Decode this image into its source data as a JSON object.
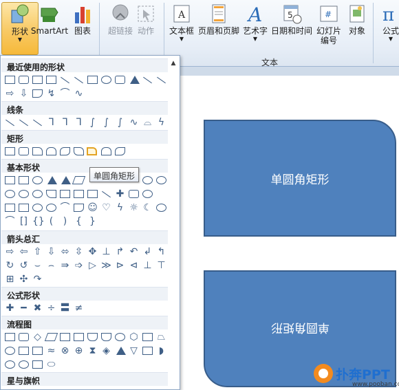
{
  "ribbon": {
    "buttons": [
      {
        "id": "shapes",
        "label": "形状",
        "icon": "shapes-icon",
        "has_dropdown": true,
        "active": true
      },
      {
        "id": "smartart",
        "label": "SmartArt",
        "icon": "smartart-icon"
      },
      {
        "id": "chart",
        "label": "图表",
        "icon": "chart-icon"
      },
      {
        "id": "hyperlink",
        "label": "超链接",
        "icon": "hyperlink-icon",
        "disabled": true
      },
      {
        "id": "action",
        "label": "动作",
        "icon": "action-icon",
        "disabled": true
      },
      {
        "id": "textbox",
        "label": "文本框",
        "icon": "textbox-icon",
        "has_dropdown": true
      },
      {
        "id": "header_footer",
        "label": "页眉和页脚",
        "icon": "header-footer-icon"
      },
      {
        "id": "wordart",
        "label": "艺术字",
        "icon": "wordart-icon",
        "has_dropdown": true
      },
      {
        "id": "datetime",
        "label": "日期和时间",
        "icon": "datetime-icon"
      },
      {
        "id": "slide_number",
        "label": "幻灯片编号",
        "label_line1": "幻灯片",
        "label_line2": "编号",
        "icon": "slide-number-icon"
      },
      {
        "id": "object",
        "label": "对象",
        "icon": "object-icon"
      },
      {
        "id": "equation",
        "label": "公式",
        "icon": "equation-icon",
        "has_dropdown": true
      }
    ],
    "group_text_label": "文本"
  },
  "shapes_panel": {
    "sections": [
      {
        "title": "最近使用的形状"
      },
      {
        "title": "线条"
      },
      {
        "title": "矩形"
      },
      {
        "title": "基本形状"
      },
      {
        "title": "箭头总汇"
      },
      {
        "title": "公式形状"
      },
      {
        "title": "流程图"
      },
      {
        "title": "星与旗帜"
      }
    ],
    "tooltip": "单圆角矩形"
  },
  "slide": {
    "shape1_text": "单圆角矩形",
    "shape2_text": "单圆角矩形",
    "shape_fill": "#4f81bd",
    "shape_border": "#385d8a"
  },
  "watermark": {
    "brand": "扑奔PPT",
    "url": "www.pooban.com"
  },
  "colors": {
    "ribbon_bg": "#e7eef7",
    "active_button": "#f8c964",
    "slide_bg": "#cfdbe9"
  }
}
